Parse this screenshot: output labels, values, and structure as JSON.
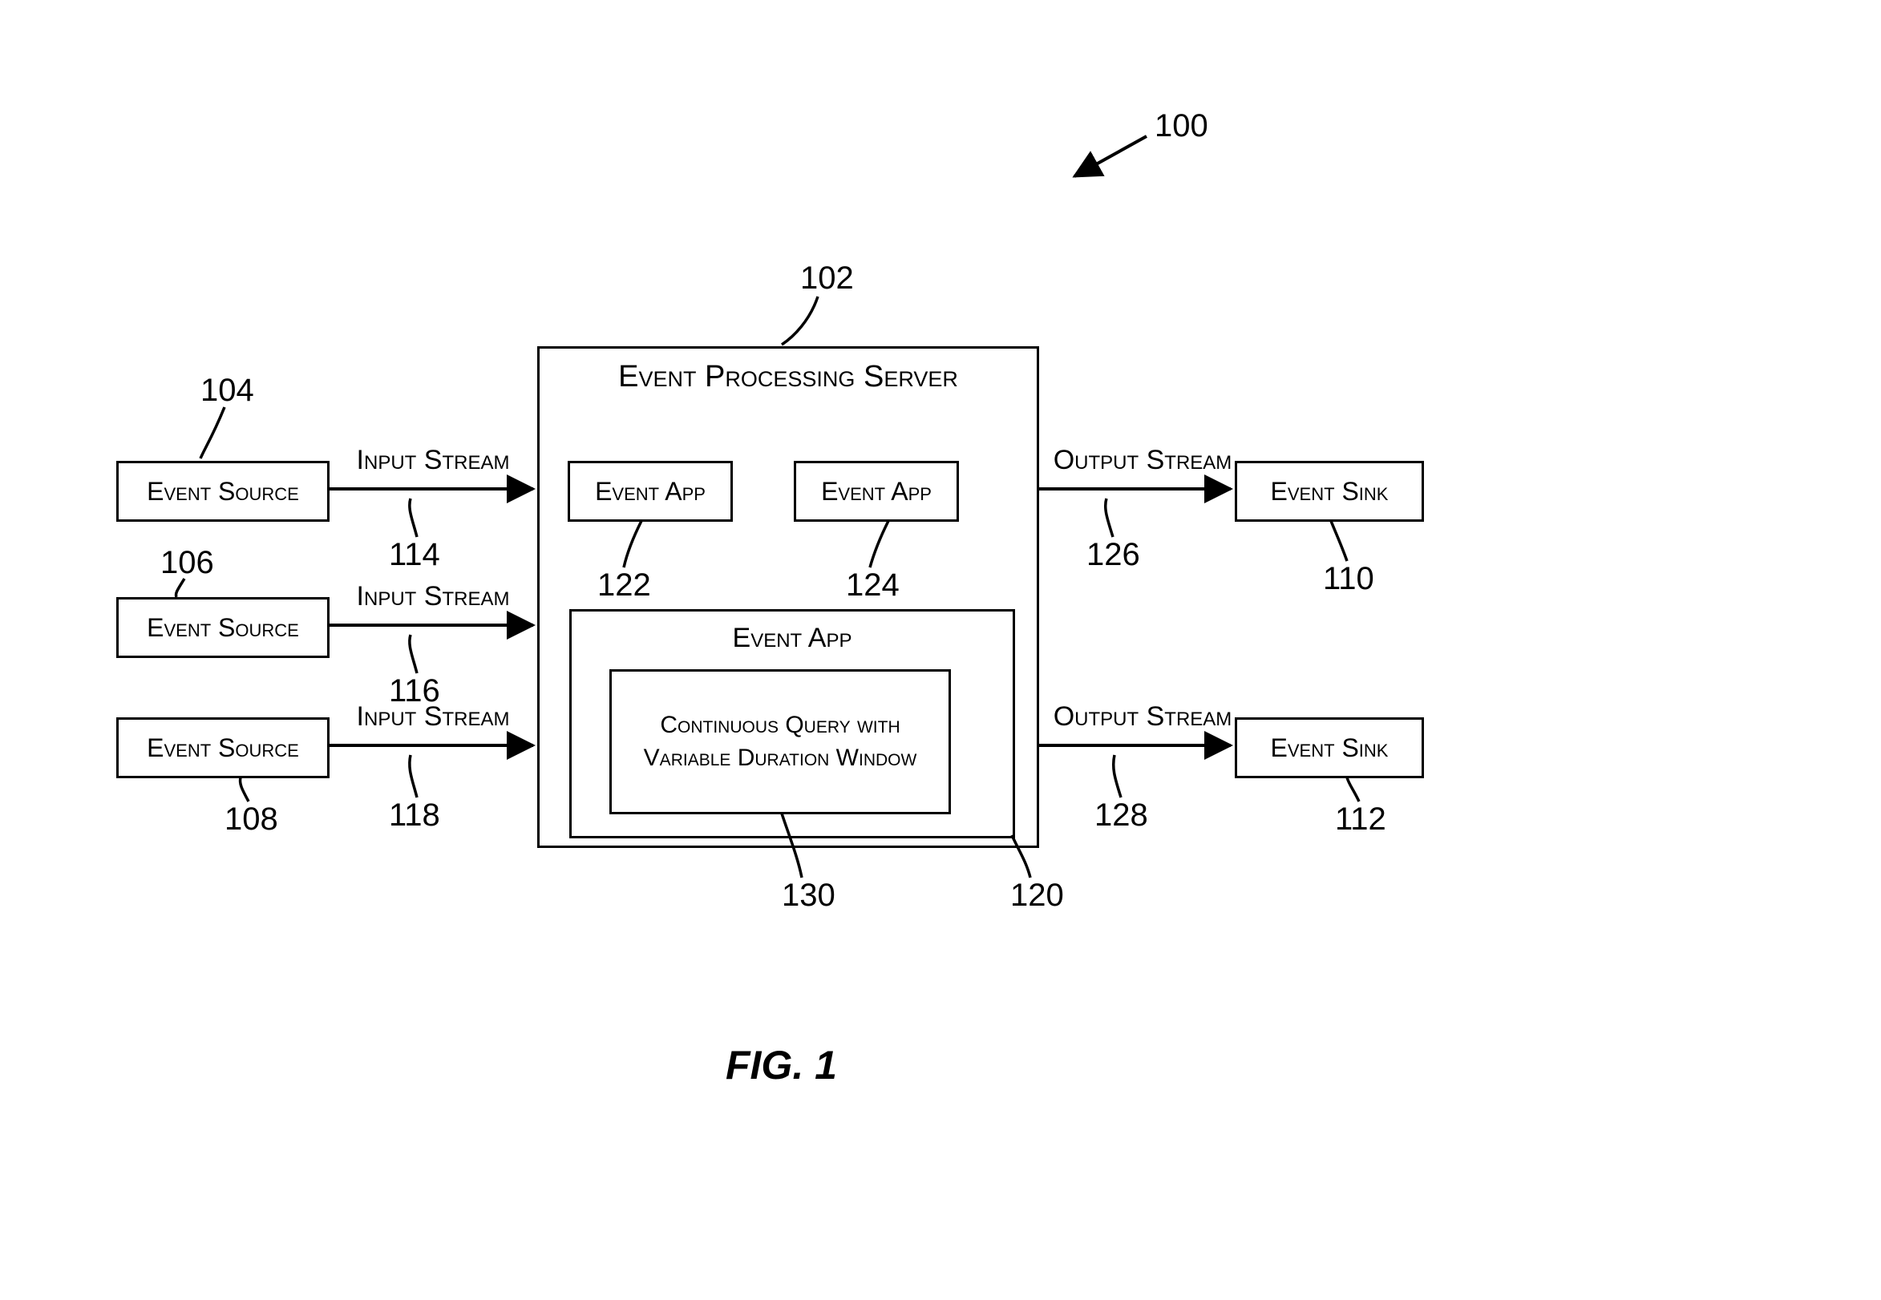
{
  "figure_caption": "FIG. 1",
  "refs": {
    "r100": "100",
    "r102": "102",
    "r104": "104",
    "r106": "106",
    "r108": "108",
    "r110": "110",
    "r112": "112",
    "r114": "114",
    "r116": "116",
    "r118": "118",
    "r120": "120",
    "r122": "122",
    "r124": "124",
    "r126": "126",
    "r128": "128",
    "r130": "130"
  },
  "blocks": {
    "server_title": "Event Processing Server",
    "event_source": "Event Source",
    "event_app": "Event App",
    "event_app_big": "Event App",
    "cq": "Continuous Query with Variable Duration Window",
    "event_sink": "Event Sink"
  },
  "streams": {
    "input": "Input Stream",
    "output": "Output Stream"
  }
}
